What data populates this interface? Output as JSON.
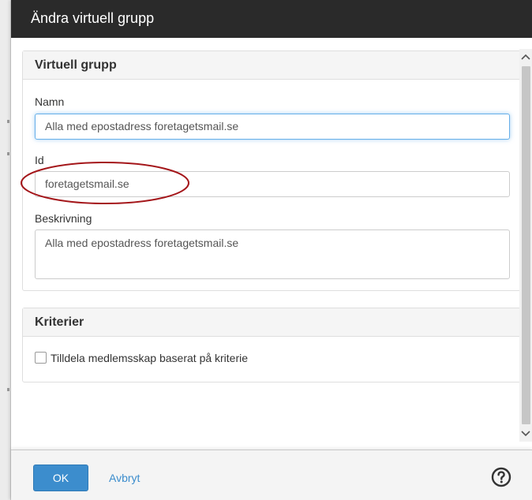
{
  "dialog": {
    "title": "Ändra virtuell grupp"
  },
  "virtual_group_panel": {
    "heading": "Virtuell grupp",
    "name_label": "Namn",
    "name_value": "Alla med epostadress foretagetsmail.se",
    "id_label": "Id",
    "id_value": "foretagetsmail.se",
    "description_label": "Beskrivning",
    "description_value": "Alla med epostadress foretagetsmail.se"
  },
  "criteria_panel": {
    "heading": "Kriterier",
    "checkbox_label": "Tilldela medlemsskap baserat på kriterie",
    "checkbox_checked": false
  },
  "footer": {
    "ok_label": "OK",
    "cancel_label": "Avbryt"
  },
  "icons": {
    "help": "question-circle-icon",
    "scroll_up": "chevron-up-icon",
    "scroll_down": "chevron-down-icon"
  },
  "colors": {
    "header_bg": "#2a2a2a",
    "primary": "#3c8dcd",
    "annotation": "#a4161a"
  }
}
